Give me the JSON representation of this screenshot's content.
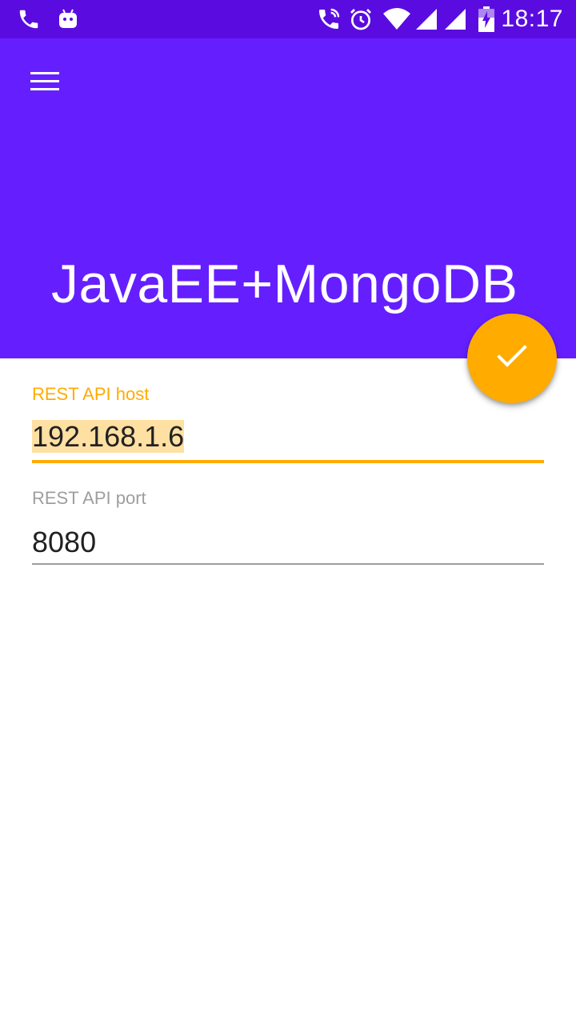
{
  "status_bar": {
    "time": "18:17",
    "icons": [
      "phone-icon",
      "android-icon",
      "wifi-call-icon",
      "alarm-icon",
      "wifi-icon",
      "signal-icon",
      "signal-icon-2",
      "battery-charging-icon"
    ]
  },
  "app_bar": {
    "menu_icon": "hamburger-menu-icon",
    "title": "JavaEE+MongoDB"
  },
  "fab": {
    "icon": "check-icon"
  },
  "form": {
    "host": {
      "label": "REST API host",
      "value": "192.168.1.6"
    },
    "port": {
      "label": "REST API port",
      "value": "8080"
    }
  },
  "colors": {
    "status_bar": "#5a0ce0",
    "primary": "#651fff",
    "accent": "#ffab00",
    "selection": "#ffe0a3",
    "hint": "#9e9e9e",
    "text": "#212121"
  }
}
